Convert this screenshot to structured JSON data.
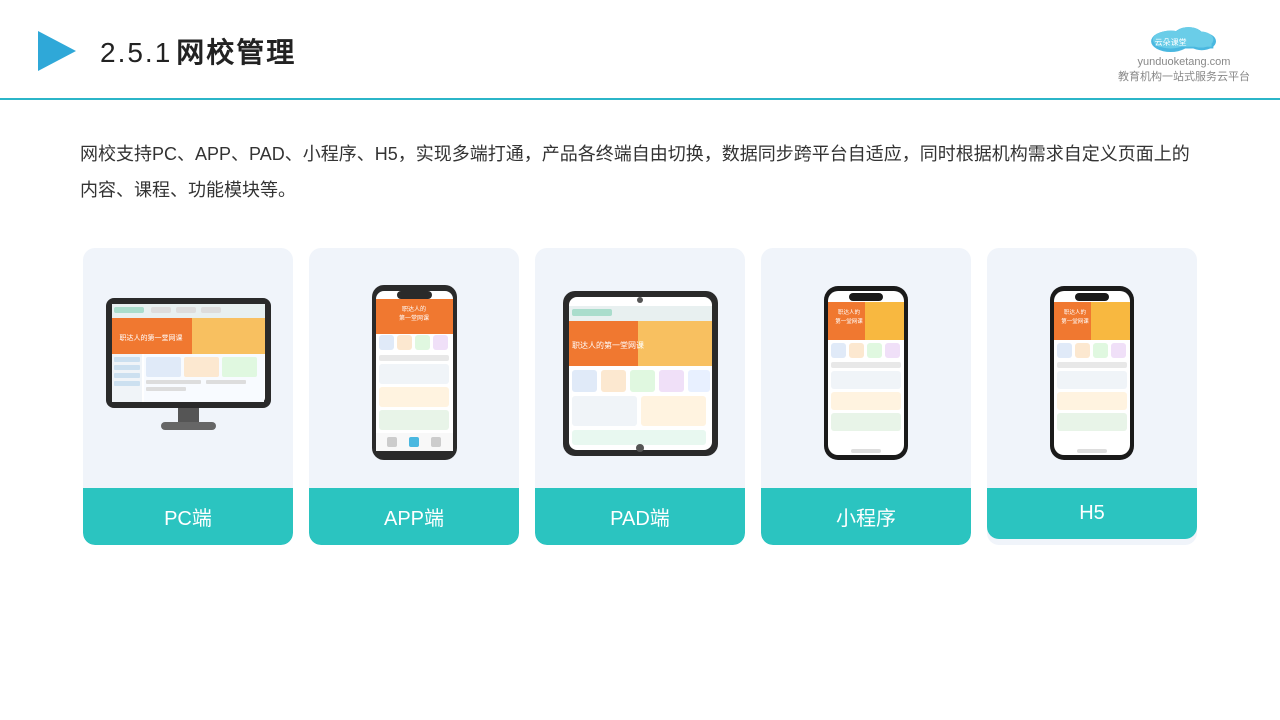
{
  "header": {
    "title": "网校管理",
    "section": "2.5.1",
    "logo_url": "yunduoketang.com",
    "logo_slogan": "教育机构一站\n式服务云平台"
  },
  "description": {
    "text": "网校支持PC、APP、PAD、小程序、H5，实现多端打通，产品各终端自由切换，数据同步跨平台自适应，同时根据机构需求自定义页面上的内容、课程、功能模块等。"
  },
  "cards": [
    {
      "label": "PC端",
      "type": "pc"
    },
    {
      "label": "APP端",
      "type": "app"
    },
    {
      "label": "PAD端",
      "type": "pad"
    },
    {
      "label": "小程序",
      "type": "miniapp"
    },
    {
      "label": "H5",
      "type": "h5"
    }
  ]
}
